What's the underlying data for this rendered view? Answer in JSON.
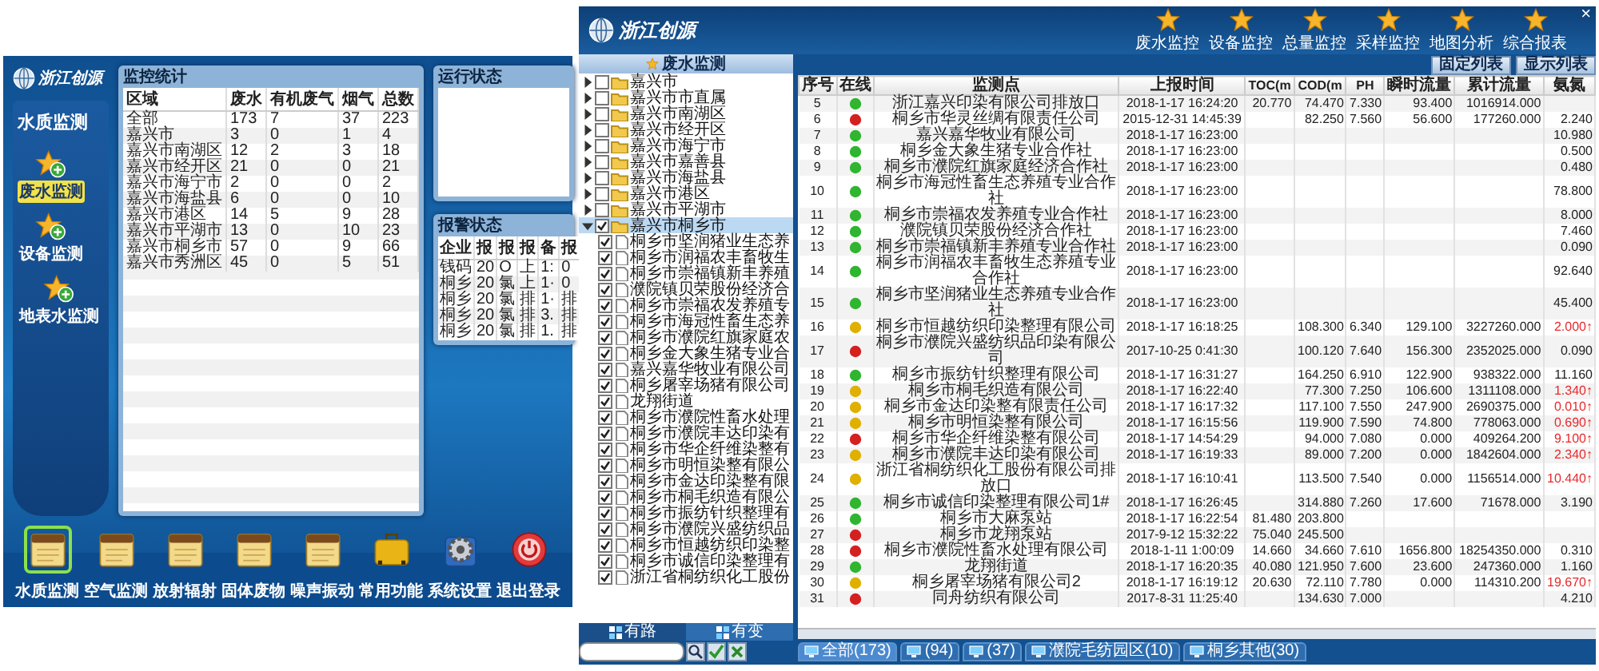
{
  "left_app": {
    "logo": "浙江创源",
    "sidebar": {
      "title": "水质监测",
      "items": [
        {
          "label": "废水监测",
          "selected": true
        },
        {
          "label": "设备监测",
          "selected": false
        },
        {
          "label": "地表水监测",
          "selected": false
        }
      ]
    },
    "stats_panel": {
      "title": "监控统计",
      "columns": [
        "区域",
        "废水",
        "有机废气",
        "烟气",
        "总数"
      ],
      "rows": [
        [
          "全部",
          "173",
          "7",
          "37",
          "223"
        ],
        [
          "嘉兴市",
          "3",
          "0",
          "1",
          "4"
        ],
        [
          "嘉兴市南湖区",
          "12",
          "2",
          "3",
          "18"
        ],
        [
          "嘉兴市经开区",
          "21",
          "0",
          "0",
          "21"
        ],
        [
          "嘉兴市海宁市",
          "2",
          "0",
          "0",
          "2"
        ],
        [
          "嘉兴市海盐县",
          "6",
          "0",
          "0",
          "10"
        ],
        [
          "嘉兴市港区",
          "14",
          "5",
          "9",
          "28"
        ],
        [
          "嘉兴市平湖市",
          "13",
          "0",
          "10",
          "23"
        ],
        [
          "嘉兴市桐乡市",
          "57",
          "0",
          "9",
          "66"
        ],
        [
          "嘉兴市秀洲区",
          "45",
          "0",
          "5",
          "51"
        ]
      ]
    },
    "status_panel": {
      "title": "运行状态"
    },
    "alarm_panel": {
      "title": "报警状态",
      "columns": [
        "企业",
        "报",
        "报",
        "报",
        "备",
        "报"
      ],
      "rows": [
        [
          "钱码",
          "20",
          "O",
          "上",
          "1:",
          "0"
        ],
        [
          "桐乡",
          "20",
          "氯",
          "上",
          "1·",
          "0"
        ],
        [
          "桐乡",
          "20",
          "氯",
          "排",
          "1·",
          "排"
        ],
        [
          "桐乡",
          "20",
          "氯",
          "排",
          "3.",
          "排"
        ],
        [
          "桐乡",
          "20",
          "氯",
          "排",
          "1.",
          "排"
        ]
      ]
    },
    "dock": [
      {
        "label": "水质监测",
        "kind": "notepad",
        "selected": true
      },
      {
        "label": "空气监测",
        "kind": "notepad",
        "selected": false
      },
      {
        "label": "放射辐射",
        "kind": "notepad",
        "selected": false
      },
      {
        "label": "固体废物",
        "kind": "notepad",
        "selected": false
      },
      {
        "label": "噪声振动",
        "kind": "notepad",
        "selected": false
      },
      {
        "label": "常用功能",
        "kind": "briefcase",
        "selected": false
      },
      {
        "label": "系统设置",
        "kind": "gear",
        "selected": false
      },
      {
        "label": "退出登录",
        "kind": "power",
        "selected": false
      }
    ]
  },
  "right_app": {
    "logo": "浙江创源",
    "close": "×",
    "nav": [
      "废水监控",
      "设备监控",
      "总量监控",
      "采样监控",
      "地图分析",
      "综合报表"
    ],
    "view_buttons": [
      "固定列表",
      "显示列表"
    ],
    "tree": {
      "title": "废水监测",
      "items": [
        {
          "label": "嘉兴市",
          "checked": false,
          "expanded": false
        },
        {
          "label": "嘉兴市市直属",
          "checked": false,
          "expanded": false
        },
        {
          "label": "嘉兴市南湖区",
          "checked": false,
          "expanded": false
        },
        {
          "label": "嘉兴市经开区",
          "checked": false,
          "expanded": false
        },
        {
          "label": "嘉兴市海宁市",
          "checked": false,
          "expanded": false
        },
        {
          "label": "嘉兴市嘉善县",
          "checked": false,
          "expanded": false
        },
        {
          "label": "嘉兴市海盐县",
          "checked": false,
          "expanded": false
        },
        {
          "label": "嘉兴市港区",
          "checked": false,
          "expanded": false
        },
        {
          "label": "嘉兴市平湖市",
          "checked": false,
          "expanded": false
        },
        {
          "label": "嘉兴市桐乡市",
          "checked": true,
          "expanded": true,
          "children": [
            {
              "label": "桐乡市坚润猪业生态养",
              "checked": true
            },
            {
              "label": "桐乡市润福农丰畜牧生",
              "checked": true
            },
            {
              "label": "桐乡市崇福镇新丰养殖",
              "checked": true
            },
            {
              "label": "濮院镇贝荣股份经济合",
              "checked": true
            },
            {
              "label": "桐乡市崇福农发养殖专",
              "checked": true
            },
            {
              "label": "桐乡市海冠性畜生态养",
              "checked": true
            },
            {
              "label": "桐乡市濮院红旗家庭农",
              "checked": true
            },
            {
              "label": "桐乡金大象生猪专业合",
              "checked": true
            },
            {
              "label": "嘉兴嘉华牧业有限公司",
              "checked": true
            },
            {
              "label": "桐乡屠宰场猪有限公司",
              "checked": true
            },
            {
              "label": "龙翔街道",
              "checked": true
            },
            {
              "label": "桐乡市濮院性畜水处理",
              "checked": true
            },
            {
              "label": "桐乡市濮院丰达印染有",
              "checked": true
            },
            {
              "label": "桐乡市华企纤维染整有",
              "checked": true
            },
            {
              "label": "桐乡市明恒染整有限公",
              "checked": true
            },
            {
              "label": "桐乡市金达印染整有限",
              "checked": true
            },
            {
              "label": "桐乡市桐毛织造有限公",
              "checked": true
            },
            {
              "label": "桐乡市振纺针织整理有",
              "checked": true
            },
            {
              "label": "桐乡市濮院兴盛纺织品",
              "checked": true
            },
            {
              "label": "桐乡市恒越纺织印染整",
              "checked": true
            },
            {
              "label": "桐乡市诚信印染整理有",
              "checked": true
            },
            {
              "label": "浙江省桐纺织化工股份",
              "checked": true
            }
          ]
        }
      ]
    },
    "tree_tabs": [
      {
        "label": "有路",
        "selected": true
      },
      {
        "label": "有变",
        "selected": false
      }
    ],
    "table": {
      "columns": [
        "序号",
        "在线",
        "监测点",
        "上报时间",
        "TOC(m",
        "COD(m",
        "PH",
        "瞬时流量",
        "累计流量",
        "氨氮"
      ],
      "rows": [
        {
          "no": "5",
          "color": "#2fb52f",
          "point": "浙江嘉兴印染有限公司排放口",
          "time": "2018-1-17 16:24:20",
          "toc": "20.770",
          "cod": "74.470",
          "ph": "7.330",
          "flow": "93.400",
          "total": "1016914.000"
        },
        {
          "no": "6",
          "color": "#d42020",
          "point": "桐乡市华灵丝绸有限责任公司",
          "time": "2015-12-31 14:45:39",
          "cod": "82.250",
          "ph": "7.560",
          "flow": "56.600",
          "total": "177260.000",
          "ammonia": "2.240",
          "ammonia_alarm": false
        },
        {
          "no": "7",
          "color": "#2fb52f",
          "point": "嘉兴嘉华牧业有限公司",
          "time": "2018-1-17 16:23:00",
          "ammonia": "10.980",
          "ammonia_alarm": false
        },
        {
          "no": "8",
          "color": "#2fb52f",
          "point": "桐乡金大象生猪专业合作社",
          "time": "2018-1-17 16:23:00",
          "ammonia": "0.500",
          "ammonia_alarm": false
        },
        {
          "no": "9",
          "color": "#2fb52f",
          "point": "桐乡市濮院红旗家庭经济合作社",
          "time": "2018-1-17 16:23:00",
          "ammonia": "0.480",
          "ammonia_alarm": false
        },
        {
          "no": "10",
          "color": "#2fb52f",
          "point": "桐乡市海冠性畜生态养殖专业合作社",
          "time": "2018-1-17 16:23:00",
          "ammonia": "78.800",
          "ammonia_alarm": false
        },
        {
          "no": "11",
          "color": "#2fb52f",
          "point": "桐乡市崇福农发养殖专业合作社",
          "time": "2018-1-17 16:23:00",
          "ammonia": "8.000",
          "ammonia_alarm": false
        },
        {
          "no": "12",
          "color": "#2fb52f",
          "point": "濮院镇贝荣股份经济合作社",
          "time": "2018-1-17 16:23:00",
          "ammonia": "7.460",
          "ammonia_alarm": false
        },
        {
          "no": "13",
          "color": "#2fb52f",
          "point": "桐乡市崇福镇新丰养殖专业合作社",
          "time": "2018-1-17 16:23:00",
          "ammonia": "0.090",
          "ammonia_alarm": false
        },
        {
          "no": "14",
          "color": "#2fb52f",
          "point": "桐乡市润福农丰畜牧生态养殖专业合作社",
          "time": "2018-1-17 16:23:00",
          "ammonia": "92.640",
          "ammonia_alarm": false
        },
        {
          "no": "15",
          "color": "#2fb52f",
          "point": "桐乡市坚润猪业生态养殖专业合作社",
          "time": "2018-1-17 16:23:00",
          "ammonia": "45.400",
          "ammonia_alarm": false
        },
        {
          "no": "16",
          "color": "#e0b000",
          "point": "桐乡市恒越纺织印染整理有限公司",
          "time": "2018-1-17 16:18:25",
          "cod": "108.300",
          "ph": "6.340",
          "flow": "129.100",
          "total": "3227260.000",
          "ammonia": "2.000↑",
          "ammonia_alarm": true
        },
        {
          "no": "17",
          "color": "#d42020",
          "point": "桐乡市濮院兴盛纺织品印染有限公司",
          "time": "2017-10-25 0:41:30",
          "cod": "100.120",
          "ph": "7.640",
          "flow": "156.300",
          "total": "2352025.000",
          "ammonia": "0.090",
          "ammonia_alarm": false
        },
        {
          "no": "18",
          "color": "#2fb52f",
          "point": "桐乡市振纺针织整理有限公司",
          "time": "2018-1-17 16:31:27",
          "cod": "164.250",
          "ph": "6.910",
          "flow": "122.900",
          "total": "938322.000",
          "ammonia": "11.160",
          "ammonia_alarm": false
        },
        {
          "no": "19",
          "color": "#e0b000",
          "point": "桐乡市桐毛织造有限公司",
          "time": "2018-1-17 16:22:40",
          "cod": "77.300",
          "ph": "7.250",
          "flow": "106.600",
          "total": "1311108.000",
          "ammonia": "1.340↑",
          "ammonia_alarm": true
        },
        {
          "no": "20",
          "color": "#e0b000",
          "point": "桐乡市金达印染整有限责任公司",
          "time": "2018-1-17 16:17:32",
          "cod": "117.100",
          "ph": "7.550",
          "flow": "247.900",
          "total": "2690375.000",
          "ammonia": "0.010↑",
          "ammonia_alarm": true
        },
        {
          "no": "21",
          "color": "#e0b000",
          "point": "桐乡市明恒染整有限公司",
          "time": "2018-1-17 16:15:56",
          "cod": "119.900",
          "ph": "7.590",
          "flow": "74.800",
          "total": "778063.000",
          "ammonia": "0.690↑",
          "ammonia_alarm": true
        },
        {
          "no": "22",
          "color": "#d42020",
          "point": "桐乡市华企纤维染整有限公司",
          "time": "2018-1-17 14:54:29",
          "cod": "94.000",
          "ph": "7.080",
          "flow": "0.000",
          "total": "409264.200",
          "ammonia": "9.100↑",
          "ammonia_alarm": true
        },
        {
          "no": "23",
          "color": "#e0b000",
          "point": "桐乡市濮院丰达印染有限公司",
          "time": "2018-1-17 16:19:33",
          "cod": "89.000",
          "ph": "7.200",
          "flow": "0.000",
          "total": "1842604.000",
          "ammonia": "2.340↑",
          "ammonia_alarm": true
        },
        {
          "no": "24",
          "color": "#e0b000",
          "point": "浙江省桐纺织化工股份有限公司排放口",
          "time": "2018-1-17 16:10:41",
          "cod": "113.500",
          "ph": "7.540",
          "flow": "0.000",
          "total": "1156514.000",
          "ammonia": "10.440↑",
          "ammonia_alarm": true
        },
        {
          "no": "25",
          "color": "#2fb52f",
          "point": "桐乡市诚信印染整理有限公司1#",
          "time": "2018-1-17 16:26:45",
          "cod": "314.880",
          "ph": "7.260",
          "flow": "17.600",
          "total": "71678.000",
          "ammonia": "3.190",
          "ammonia_alarm": false
        },
        {
          "no": "26",
          "color": "#2fb52f",
          "point": "桐乡市大麻泵站",
          "time": "2018-1-17 16:22:54",
          "toc": "81.480",
          "cod": "203.800"
        },
        {
          "no": "27",
          "color": "#d42020",
          "point": "桐乡市龙翔泵站",
          "time": "2017-9-12 15:32:22",
          "toc": "75.040",
          "cod": "245.500"
        },
        {
          "no": "28",
          "color": "#d42020",
          "point": "桐乡市濮院性畜水处理有限公司",
          "time": "2018-1-11 1:00:09",
          "toc": "14.660",
          "cod": "34.660",
          "ph": "7.610",
          "flow": "1656.800",
          "total": "18254350.000",
          "ammonia": "0.310",
          "ammonia_alarm": false
        },
        {
          "no": "29",
          "color": "#2fb52f",
          "point": "龙翔街道",
          "time": "2018-1-17 16:20:35",
          "toc": "40.080",
          "cod": "121.950",
          "ph": "7.600",
          "flow": "23.600",
          "total": "247360.000",
          "ammonia": "1.160",
          "ammonia_alarm": false
        },
        {
          "no": "30",
          "color": "#e0b000",
          "point": "桐乡屠宰场猪有限公司2",
          "time": "2018-1-17 16:19:12",
          "toc": "20.630",
          "cod": "72.110",
          "ph": "7.780",
          "flow": "0.000",
          "total": "114310.200",
          "ammonia": "19.670↑",
          "ammonia_alarm": true
        },
        {
          "no": "31",
          "color": "#d42020",
          "point": "同舟纺织有限公司",
          "time": "2017-8-31 11:25:40",
          "cod": "134.630",
          "ph": "7.000",
          "ammonia": "4.210",
          "ammonia_alarm": false
        }
      ]
    },
    "filter_tabs": [
      {
        "label": "全部(173)",
        "selected": true
      },
      {
        "label": "(94)",
        "selected": false
      },
      {
        "label": "(37)",
        "selected": false
      },
      {
        "label": "濮院毛纺园区(10)",
        "selected": false
      },
      {
        "label": "桐乡其他(30)",
        "selected": false
      }
    ]
  }
}
